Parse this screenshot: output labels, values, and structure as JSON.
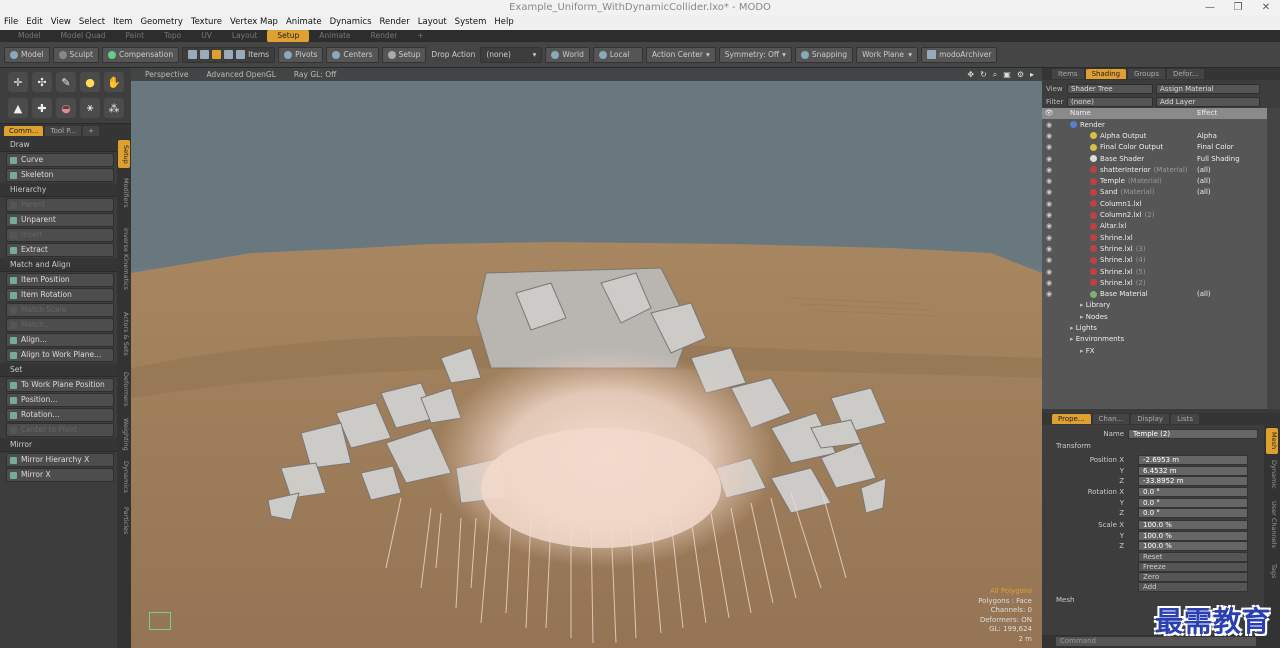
{
  "window": {
    "title": "Example_Uniform_WithDynamicCollider.lxo* - MODO",
    "controls": [
      "—",
      "❐",
      "✕"
    ]
  },
  "menu": [
    "File",
    "Edit",
    "View",
    "Select",
    "Item",
    "Geometry",
    "Texture",
    "Vertex Map",
    "Animate",
    "Dynamics",
    "Render",
    "Layout",
    "System",
    "Help"
  ],
  "layout_tabs": [
    {
      "label": "Model"
    },
    {
      "label": "Model Quad"
    },
    {
      "label": "Paint"
    },
    {
      "label": "Topo"
    },
    {
      "label": "UV"
    },
    {
      "label": "Layout"
    },
    {
      "label": "Setup",
      "active": true
    },
    {
      "label": "Animate"
    },
    {
      "label": "Render"
    },
    {
      "label": "+"
    }
  ],
  "toolbar": {
    "model": "Model",
    "sculpt": "Sculpt",
    "compensation": "Compensation",
    "items": "Items",
    "pivots": "Pivots",
    "centers": "Centers",
    "setup": "Setup",
    "drop_action": "Drop Action",
    "drop_value": "(none)",
    "world": "World",
    "local": "Local",
    "action_center": "Action Center",
    "symmetry": "Symmetry: Off",
    "snapping": "Snapping",
    "work_plane": "Work Plane",
    "archiver": "modoArchiver"
  },
  "left_tabs": [
    {
      "label": "Comm...",
      "active": true
    },
    {
      "label": "Tool P..."
    },
    {
      "label": "+"
    }
  ],
  "left_panel": [
    {
      "type": "section",
      "label": "Draw"
    },
    {
      "type": "button",
      "label": "Curve"
    },
    {
      "type": "button",
      "label": "Skeleton"
    },
    {
      "type": "section",
      "label": "Hierarchy"
    },
    {
      "type": "button",
      "label": "Parent",
      "disabled": true
    },
    {
      "type": "button",
      "label": "Unparent"
    },
    {
      "type": "button",
      "label": "Insert",
      "disabled": true
    },
    {
      "type": "button",
      "label": "Extract"
    },
    {
      "type": "section",
      "label": "Match and Align"
    },
    {
      "type": "button",
      "label": "Item Position"
    },
    {
      "type": "button",
      "label": "Item Rotation"
    },
    {
      "type": "button",
      "label": "Match Scale",
      "disabled": true
    },
    {
      "type": "button",
      "label": "Match...",
      "disabled": true
    },
    {
      "type": "button",
      "label": "Align..."
    },
    {
      "type": "button",
      "label": "Align to Work Plane..."
    },
    {
      "type": "section",
      "label": "Set"
    },
    {
      "type": "button",
      "label": "To Work Plane Position"
    },
    {
      "type": "button",
      "label": "Position..."
    },
    {
      "type": "button",
      "label": "Rotation..."
    },
    {
      "type": "button",
      "label": "Center to Pivot",
      "disabled": true
    },
    {
      "type": "section",
      "label": "Mirror"
    },
    {
      "type": "button",
      "label": "Mirror Hierarchy X"
    },
    {
      "type": "button",
      "label": "Mirror X"
    }
  ],
  "left_vtabs": [
    {
      "label": "Setup",
      "active": true
    },
    {
      "label": "Modifiers"
    },
    {
      "label": "Inverse Kinematics"
    },
    {
      "label": "Actors & Sets"
    },
    {
      "label": "Deformers"
    },
    {
      "label": "Weighting"
    },
    {
      "label": "Dynamics"
    },
    {
      "label": "Particles"
    }
  ],
  "viewport": {
    "view": "Perspective",
    "shading": "Advanced OpenGL",
    "raygl": "Ray GL: Off",
    "info": {
      "selection": "All Polygons",
      "polygons": "Polygons : Face",
      "channels": "Channels: 0",
      "deformers": "Deformers: ON",
      "gl": "GL: 199,624",
      "scale": "2 m"
    }
  },
  "right_tabs": [
    {
      "label": "Items"
    },
    {
      "label": "Shading",
      "active": true
    },
    {
      "label": "Groups"
    },
    {
      "label": "Defor..."
    }
  ],
  "shader_ctrl": {
    "view_label": "View",
    "view_value": "Shader Tree",
    "assign": "Assign Material",
    "filter_label": "Filter",
    "filter_value": "(none)",
    "add_layer": "Add Layer"
  },
  "shader_columns": {
    "name": "Name",
    "effect": "Effect"
  },
  "shader_tree": [
    {
      "name": "Render",
      "effect": "",
      "indent": 0,
      "color": "#5a7fd0",
      "eye": true
    },
    {
      "name": "Alpha Output",
      "effect": "Alpha",
      "indent": 2,
      "color": "#d8c040",
      "eye": true
    },
    {
      "name": "Final Color Output",
      "effect": "Final Color",
      "indent": 2,
      "color": "#d8c040",
      "eye": true
    },
    {
      "name": "Base Shader",
      "effect": "Full Shading",
      "indent": 2,
      "color": "#dddddd",
      "eye": true
    },
    {
      "name": "shatterInterior",
      "sub": "(Material)",
      "effect": "(all)",
      "indent": 2,
      "color": "#c04040",
      "eye": true
    },
    {
      "name": "Temple",
      "sub": "(Material)",
      "effect": "(all)",
      "indent": 2,
      "color": "#c04040",
      "eye": true
    },
    {
      "name": "Sand",
      "sub": "(Material)",
      "effect": "(all)",
      "indent": 2,
      "color": "#c04040",
      "eye": true
    },
    {
      "name": "Column1.lxl",
      "effect": "",
      "indent": 2,
      "color": "#c04040",
      "eye": true
    },
    {
      "name": "Column2.lxl",
      "sub": "(2)",
      "effect": "",
      "indent": 2,
      "color": "#c04040",
      "eye": true
    },
    {
      "name": "Altar.lxl",
      "effect": "",
      "indent": 2,
      "color": "#c04040",
      "eye": true
    },
    {
      "name": "Shrine.lxl",
      "effect": "",
      "indent": 2,
      "color": "#c04040",
      "eye": true
    },
    {
      "name": "Shrine.lxl",
      "sub": "(3)",
      "effect": "",
      "indent": 2,
      "color": "#c04040",
      "eye": true
    },
    {
      "name": "Shrine.lxl",
      "sub": "(4)",
      "effect": "",
      "indent": 2,
      "color": "#c04040",
      "eye": true
    },
    {
      "name": "Shrine.lxl",
      "sub": "(5)",
      "effect": "",
      "indent": 2,
      "color": "#c04040",
      "eye": true
    },
    {
      "name": "Shrine.lxl",
      "sub": "(2)",
      "effect": "",
      "indent": 2,
      "color": "#c04040",
      "eye": true
    },
    {
      "name": "Base Material",
      "effect": "(all)",
      "indent": 2,
      "color": "#7fb070",
      "eye": true
    },
    {
      "name": "Library",
      "effect": "",
      "indent": 1,
      "color": "",
      "eye": false
    },
    {
      "name": "Nodes",
      "effect": "",
      "indent": 1,
      "color": "",
      "eye": false
    },
    {
      "name": "Lights",
      "effect": "",
      "indent": 0,
      "color": "",
      "eye": false
    },
    {
      "name": "Environments",
      "effect": "",
      "indent": 0,
      "color": "",
      "eye": false
    },
    {
      "name": "FX",
      "effect": "",
      "indent": 1,
      "color": "",
      "eye": false
    }
  ],
  "props_tabs": [
    {
      "label": "Prope...",
      "active": true
    },
    {
      "label": "Chan..."
    },
    {
      "label": "Display"
    },
    {
      "label": "Lists"
    }
  ],
  "props": {
    "name_label": "Name",
    "name_value": "Temple (2)",
    "transform": "Transform",
    "pos_label": "Position X",
    "pos": [
      "-2.6953 m",
      "6.4532 m",
      "-33.8952 m"
    ],
    "rot_label": "Rotation X",
    "rot": [
      "0.0 °",
      "0.0 °",
      "0.0 °"
    ],
    "scale_label": "Scale X",
    "scale": [
      "100.0 %",
      "100.0 %",
      "100.0 %"
    ],
    "y": "Y",
    "z": "Z",
    "actions": [
      "Reset",
      "Freeze",
      "Zero",
      "Add"
    ],
    "mesh": "Mesh"
  },
  "props_vtabs": [
    {
      "label": "Mesh",
      "active": true
    },
    {
      "label": "Dynamic"
    },
    {
      "label": "User Channels"
    },
    {
      "label": "Tags"
    }
  ],
  "command": "Command",
  "watermark": "最需教育"
}
